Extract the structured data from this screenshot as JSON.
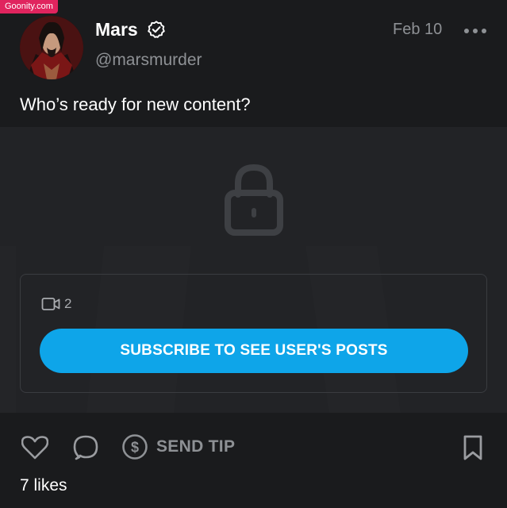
{
  "watermark": "Goonity.com",
  "post": {
    "author_name": "Mars",
    "handle": "@marsmurder",
    "date": "Feb 10",
    "caption": "Who’s ready for new content?",
    "verified": true
  },
  "media": {
    "locked": true,
    "video_count": "2",
    "subscribe_label": "SUBSCRIBE TO SEE USER'S POSTS"
  },
  "actions": {
    "send_tip_label": "SEND TIP",
    "likes_text": "7 likes"
  },
  "icons": {
    "verified": "check-badge-icon",
    "more": "more-horizontal-icon",
    "lock": "lock-icon",
    "video": "video-camera-icon",
    "like": "heart-icon",
    "comment": "comment-bubble-icon",
    "tip": "dollar-circle-icon",
    "bookmark": "bookmark-icon"
  },
  "colors": {
    "background": "#1a1b1d",
    "media_background": "#222326",
    "accent": "#0ea5e9",
    "muted_text": "#8e9195",
    "watermark": "#e0245e"
  }
}
